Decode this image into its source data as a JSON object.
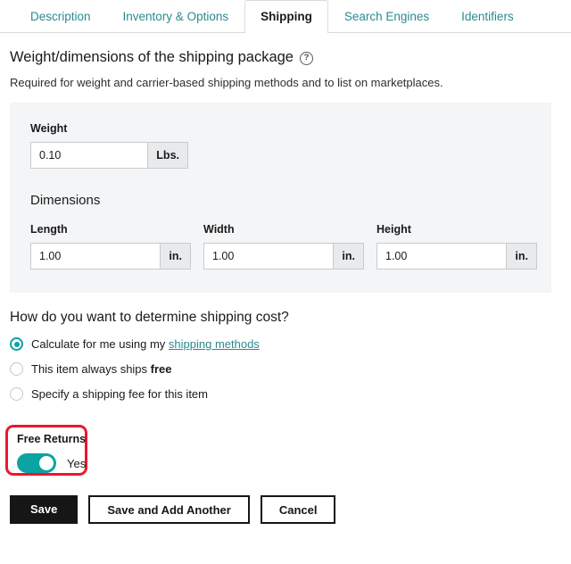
{
  "tabs": [
    {
      "label": "Description",
      "active": false
    },
    {
      "label": "Inventory & Options",
      "active": false
    },
    {
      "label": "Shipping",
      "active": true
    },
    {
      "label": "Search Engines",
      "active": false
    },
    {
      "label": "Identifiers",
      "active": false
    }
  ],
  "section": {
    "title": "Weight/dimensions of the shipping package",
    "help_icon": "question-mark-circle-icon",
    "help_glyph": "?",
    "subtitle": "Required for weight and carrier-based shipping methods and to list on marketplaces."
  },
  "weight": {
    "label": "Weight",
    "value": "0.10",
    "placeholder": "",
    "unit": "Lbs."
  },
  "dimensions": {
    "title": "Dimensions",
    "fields": [
      {
        "label": "Length",
        "value": "1.00",
        "unit": "in.",
        "placeholder": ""
      },
      {
        "label": "Width",
        "value": "1.00",
        "unit": "in.",
        "placeholder": ""
      },
      {
        "label": "Height",
        "value": "1.00",
        "unit": "in.",
        "placeholder": ""
      }
    ]
  },
  "shipping_cost": {
    "question": "How do you want to determine shipping cost?",
    "options": [
      {
        "text_before": "Calculate for me using my ",
        "link": "shipping methods",
        "text_after": "",
        "selected": true
      },
      {
        "text_before": "This item always ships ",
        "strong": "free",
        "text_after": "",
        "selected": false
      },
      {
        "text_before": "Specify a shipping fee for this item",
        "selected": false
      }
    ]
  },
  "free_returns": {
    "label": "Free Returns",
    "toggle_state": "on",
    "toggle_text": "Yes",
    "annotation": "red-highlight-box"
  },
  "buttons": {
    "save": "Save",
    "save_and_add_another": "Save and Add Another",
    "cancel": "Cancel"
  },
  "colors": {
    "accent_teal": "#0ca3a3",
    "link_teal": "#2b8a8f",
    "annotation_red": "#e8192c",
    "panel_bg": "#f4f5f7",
    "button_dark": "#161616"
  }
}
